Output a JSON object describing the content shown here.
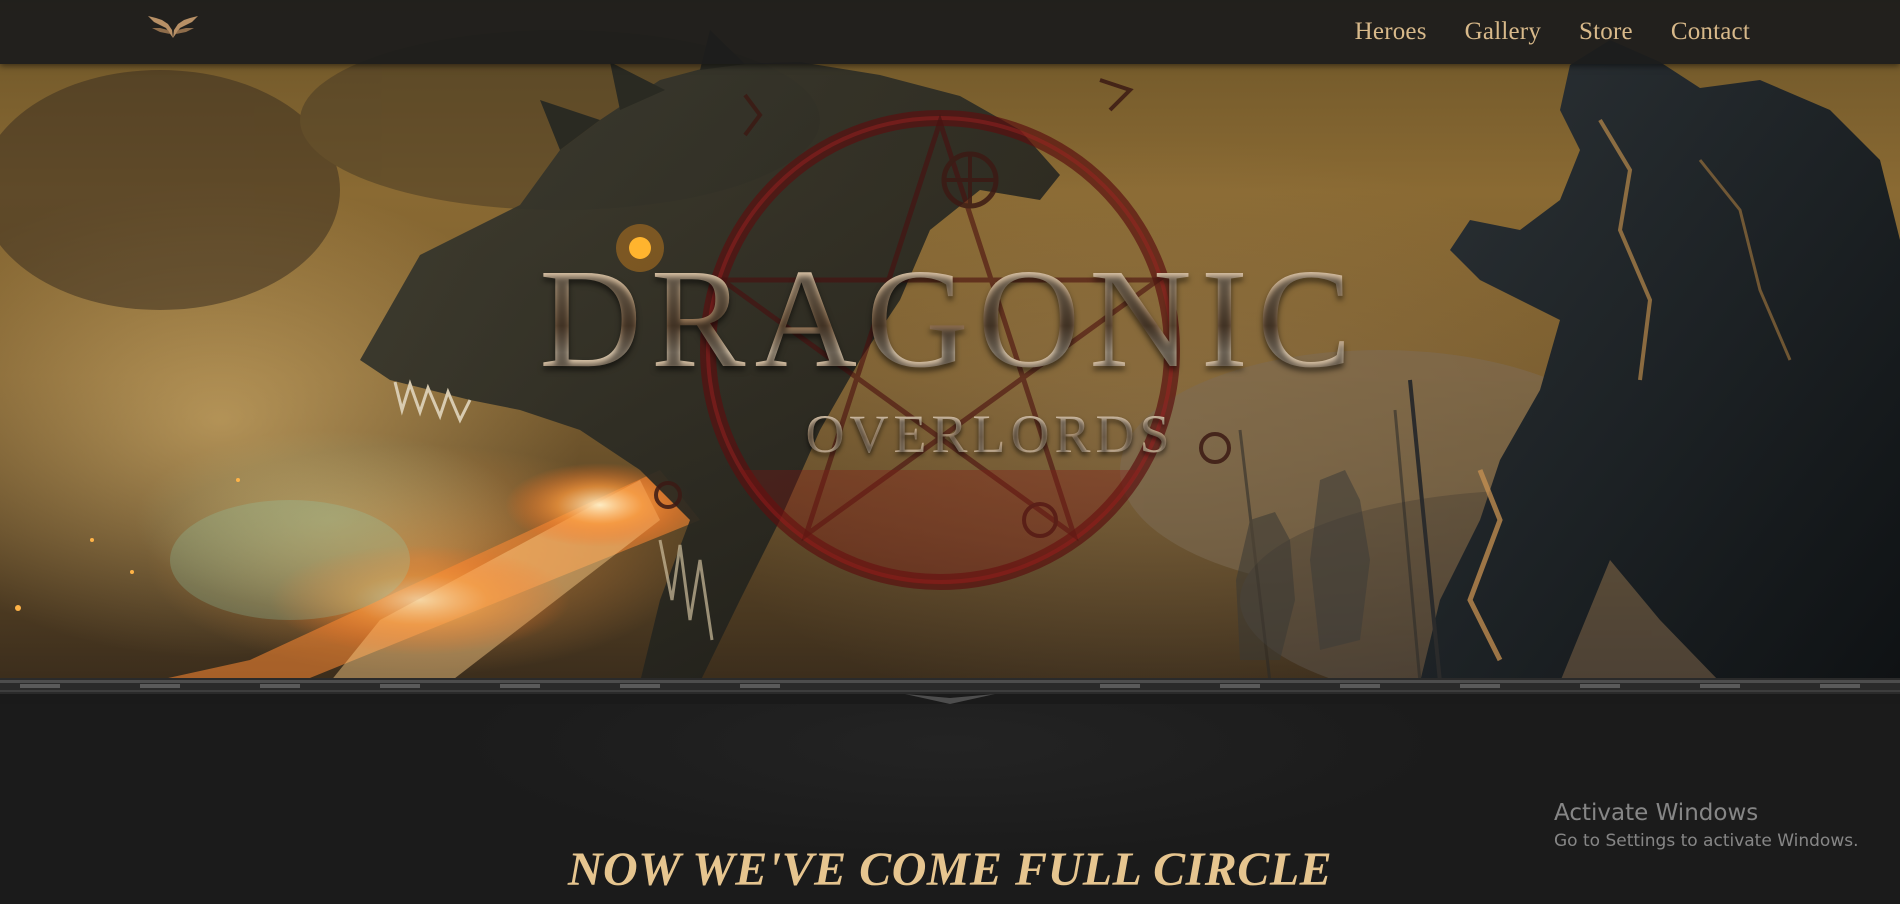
{
  "nav": {
    "logo_icon": "winged-emblem-icon",
    "links": [
      {
        "label": "Heroes"
      },
      {
        "label": "Gallery"
      },
      {
        "label": "Store"
      },
      {
        "label": "Contact"
      }
    ],
    "link_color": "#d8b98a"
  },
  "hero": {
    "title": "DRAGONIC",
    "subtitle": "OVERLORDS",
    "emblem_icon": "pentagram-sigil-icon",
    "background_art": "dragon-and-armored-knight-illustration"
  },
  "section": {
    "tagline": "NOW WE'VE COME FULL CIRCLE",
    "tagline_color": "#e6c58f"
  },
  "watermark": {
    "title": "Activate Windows",
    "subtitle": "Go to Settings to activate Windows."
  }
}
